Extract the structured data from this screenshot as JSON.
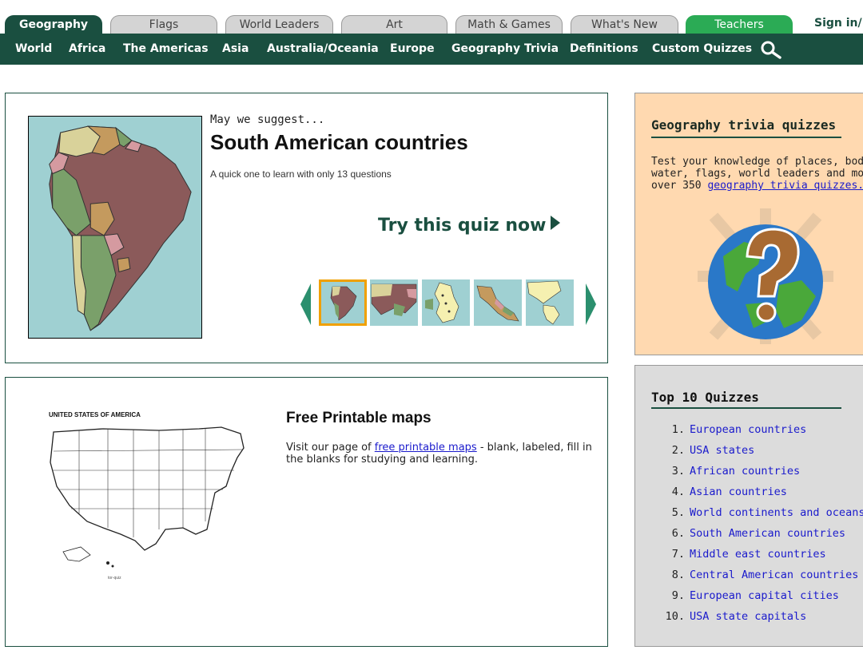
{
  "top_tabs": [
    {
      "label": "Geography"
    },
    {
      "label": "Flags"
    },
    {
      "label": "World Leaders"
    },
    {
      "label": "Art"
    },
    {
      "label": "Math & Games"
    },
    {
      "label": "What's New"
    },
    {
      "label": "Teachers"
    }
  ],
  "sign_in": "Sign in/",
  "sub_nav": [
    {
      "label": "World"
    },
    {
      "label": "Africa"
    },
    {
      "label": "The Americas"
    },
    {
      "label": "Asia"
    },
    {
      "label": "Australia/Oceania"
    },
    {
      "label": "Europe"
    },
    {
      "label": "Geography Trivia"
    },
    {
      "label": "Definitions"
    },
    {
      "label": "Custom Quizzes"
    }
  ],
  "suggest": {
    "kicker": "May we suggest...",
    "title": "South American countries",
    "description": "A quick one to learn with only 13 questions",
    "cta": "Try this quiz now"
  },
  "printable": {
    "map_title": "UNITED STATES OF AMERICA",
    "title": "Free Printable maps",
    "text_before": "Visit our page of ",
    "link": "free printable maps",
    "text_after": " - blank, labeled, fill in the blanks for studying and learning."
  },
  "trivia": {
    "title": "Geography trivia quizzes",
    "line1": "Test your knowledge of places, bodie",
    "line2": "water, flags, world leaders and more",
    "line3_before": "over 350 ",
    "link": "geography trivia quizzes."
  },
  "top10": {
    "title": "Top 10 Quizzes",
    "items": [
      {
        "num": "1.",
        "label": "European countries"
      },
      {
        "num": "2.",
        "label": "USA states"
      },
      {
        "num": "3.",
        "label": "African countries"
      },
      {
        "num": "4.",
        "label": "Asian countries"
      },
      {
        "num": "5.",
        "label": "World continents and oceans"
      },
      {
        "num": "6.",
        "label": "South American countries"
      },
      {
        "num": "7.",
        "label": "Middle east countries"
      },
      {
        "num": "8.",
        "label": "Central American countries"
      },
      {
        "num": "9.",
        "label": "European capital cities"
      },
      {
        "num": "10.",
        "label": "USA state capitals"
      }
    ]
  },
  "colors": {
    "brand": "#1a4f40",
    "teachers": "#2bab55",
    "selected_thumb": "#f0a000",
    "link": "#1a1acc"
  }
}
